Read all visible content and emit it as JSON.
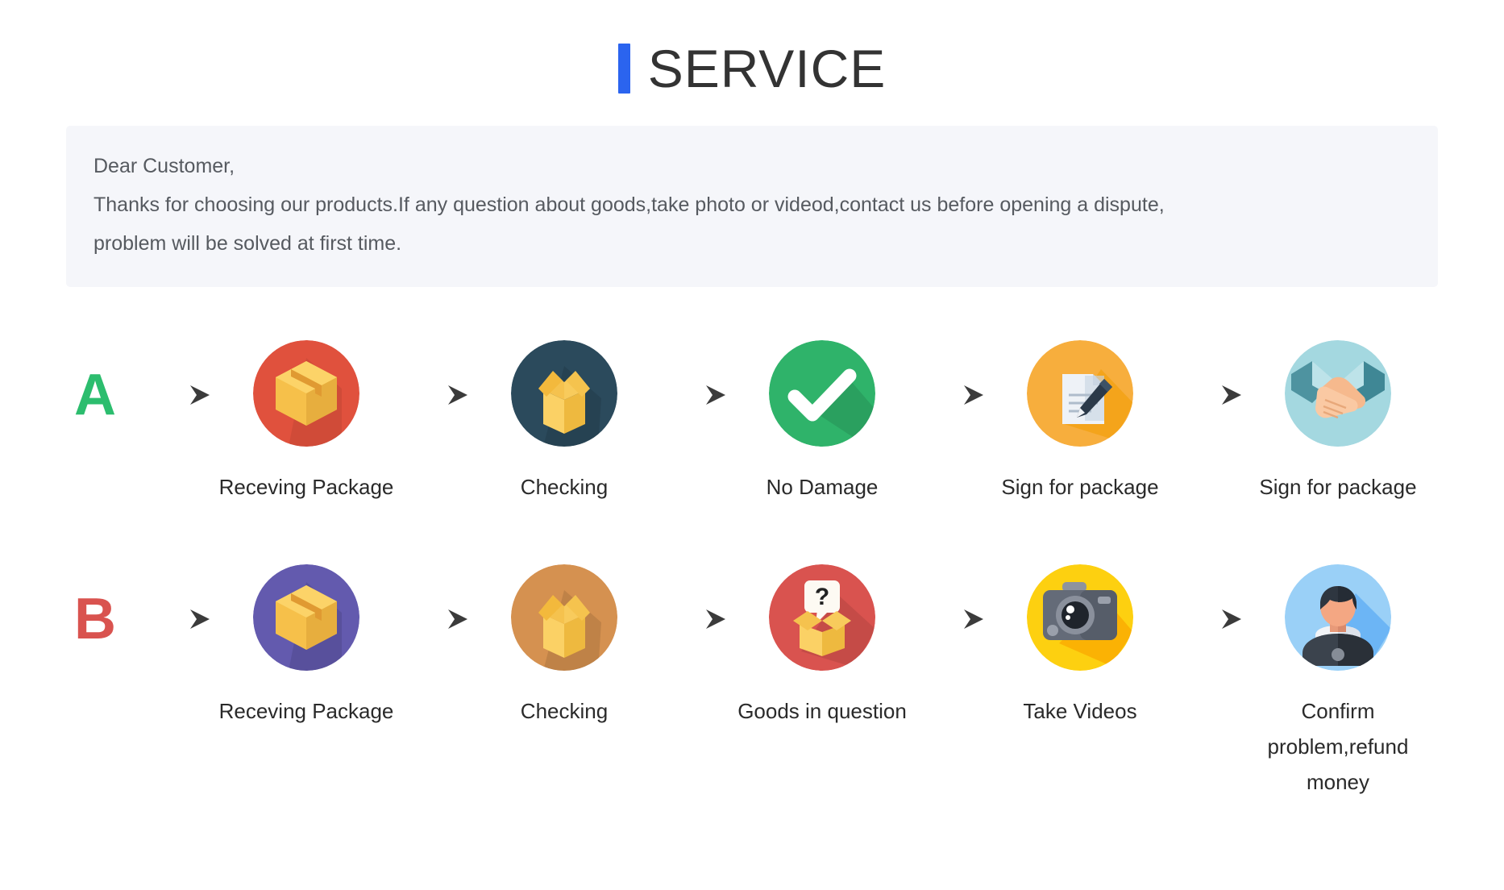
{
  "header": {
    "title": "SERVICE",
    "accent_color": "#2b64ef"
  },
  "notice": {
    "lines": [
      "Dear Customer,",
      "Thanks for choosing our products.If any question about goods,take photo or videod,contact us before opening a dispute,",
      "problem will be solved at first time."
    ],
    "background_color": "#f5f6fa",
    "text_color": "#565a60"
  },
  "flows": [
    {
      "letter": "A",
      "letter_color": "#2cbd6e",
      "steps": [
        {
          "label": "Receving Package",
          "icon": "closed-package-icon",
          "circle_color": "#e0513d"
        },
        {
          "label": "Checking",
          "icon": "open-package-icon",
          "circle_color": "#2b4a5c"
        },
        {
          "label": "No Damage",
          "icon": "check-mark-icon",
          "circle_color": "#2fb36a"
        },
        {
          "label": "Sign for package",
          "icon": "document-pen-icon",
          "circle_color": "#f7ae3d"
        },
        {
          "label": "Sign for package",
          "icon": "handshake-icon",
          "circle_color": "#a4d8e0"
        }
      ]
    },
    {
      "letter": "B",
      "letter_color": "#d9534f",
      "steps": [
        {
          "label": "Receving Package",
          "icon": "closed-package-icon",
          "circle_color": "#635aae"
        },
        {
          "label": "Checking",
          "icon": "open-package-icon",
          "circle_color": "#d59150"
        },
        {
          "label": "Goods in question",
          "icon": "question-package-icon",
          "circle_color": "#d9534f"
        },
        {
          "label": "Take Videos",
          "icon": "camera-icon",
          "circle_color": "#fdd010"
        },
        {
          "label": "Confirm problem,refund money",
          "icon": "support-person-icon",
          "circle_color": "#9ad0f7"
        }
      ]
    }
  ],
  "arrow": {
    "name": "right-arrow-icon",
    "color": "#444444"
  }
}
